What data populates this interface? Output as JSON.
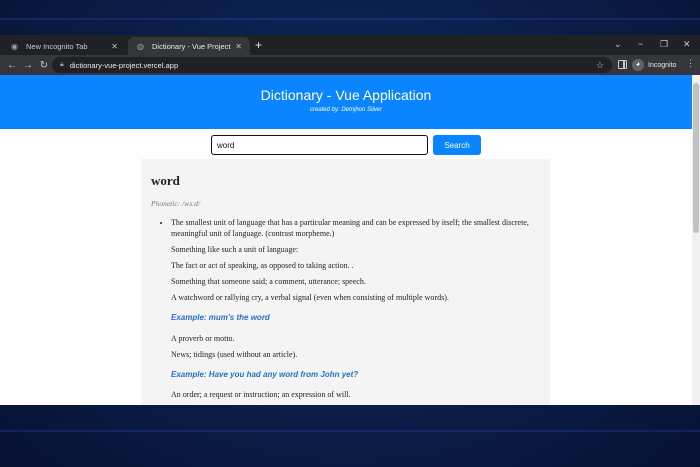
{
  "browser": {
    "tabs": [
      {
        "title": "New Incognito Tab",
        "icon": "incognito-icon",
        "active": false
      },
      {
        "title": "Dictionary - Vue Project",
        "icon": "globe-icon",
        "active": true
      }
    ],
    "url": "dictionary-vue-project.vercel.app",
    "profile_label": "Incognito"
  },
  "app": {
    "title": "Dictionary - Vue Application",
    "credit": "created by: Demjhon Silver",
    "accent_color": "#0a84ff"
  },
  "search": {
    "value": "word",
    "button_label": "Search"
  },
  "result": {
    "word": "word",
    "phonetic": "Phonetic: /wɜːd/",
    "first_definition": "The smallest unit of language that has a particular meaning and can be expressed by itself; the smallest discrete, meaningful unit of language. (contrast morpheme.)",
    "definitions": [
      "Something like such a unit of language:",
      "The fact or act of speaking, as opposed to taking action. .",
      "Something that someone said; a comment, utterance; speech.",
      "A watchword or rallying cry, a verbal signal (even when consisting of multiple words)."
    ],
    "example_1": "Example: mum's the word",
    "definitions_2": [
      "A proverb or motto.",
      "News; tidings (used without an article)."
    ],
    "example_2": "Example: Have you had any word from John yet?",
    "definitions_3": [
      "An order; a request or instruction; an expression of will."
    ]
  }
}
